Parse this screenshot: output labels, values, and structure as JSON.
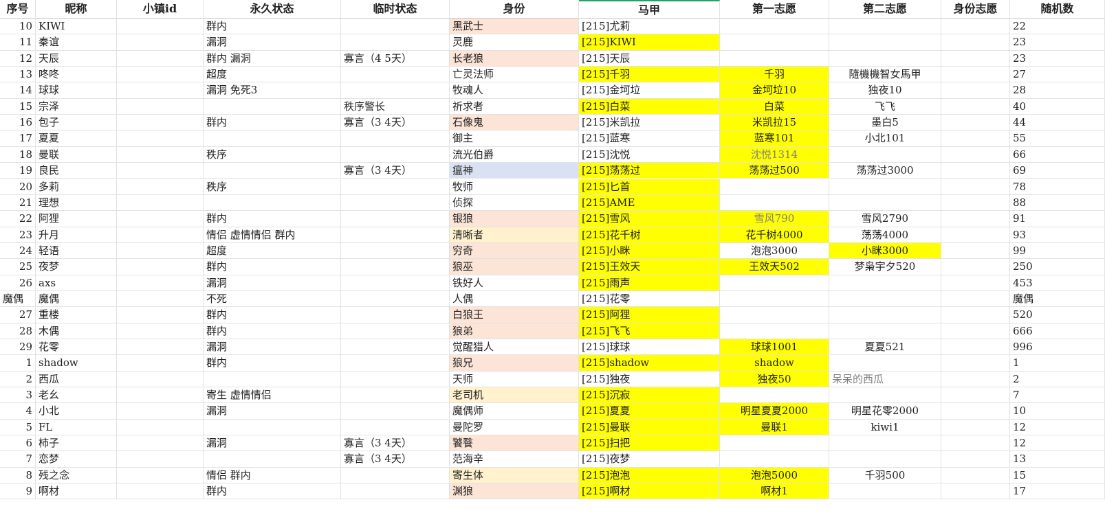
{
  "colors": {
    "yellow": "#ffff00",
    "peach": "#fce4d6",
    "cream": "#fff2cc",
    "lavender": "#d9e1f2",
    "header_accent": "#21a366",
    "text_gray": "#7f7f7f",
    "text_dark": "#333333"
  },
  "columns": [
    {
      "key": "seq",
      "label": "序号",
      "align": "num"
    },
    {
      "key": "nick",
      "label": "昵称",
      "align": "lft"
    },
    {
      "key": "townid",
      "label": "小镇id",
      "align": "lft"
    },
    {
      "key": "perm",
      "label": "永久状态",
      "align": "lft"
    },
    {
      "key": "temp",
      "label": "临时状态",
      "align": "lft"
    },
    {
      "key": "role",
      "label": "身份",
      "align": "lft"
    },
    {
      "key": "alt",
      "label": "马甲",
      "align": "lft",
      "active": true
    },
    {
      "key": "wish1",
      "label": "第一志愿",
      "align": "ctr"
    },
    {
      "key": "wish2",
      "label": "第二志愿",
      "align": "ctr"
    },
    {
      "key": "rolewish",
      "label": "身份志愿",
      "align": "ctr"
    },
    {
      "key": "rand",
      "label": "随机数",
      "align": "lft"
    }
  ],
  "rows": [
    {
      "seq": "10",
      "nick": "KIWI",
      "perm": "群内",
      "temp": "",
      "role": "黑武士",
      "alt": "[215]尤莉",
      "wish1": "",
      "wish2": "",
      "rand": "22",
      "bg": {
        "role": "peach"
      }
    },
    {
      "seq": "11",
      "nick": "秦谊",
      "perm": "漏洞",
      "temp": "",
      "role": "灵鹿",
      "alt": "[215]KIWI",
      "wish1": "",
      "wish2": "",
      "rand": "23",
      "bg": {
        "alt": "yellow"
      }
    },
    {
      "seq": "12",
      "nick": "天辰",
      "perm": "群内 漏洞",
      "temp": "寡言（4 5天）",
      "role": "长老狼",
      "alt": "[215]天辰",
      "wish1": "",
      "wish2": "",
      "rand": "23",
      "bg": {
        "role": "peach"
      }
    },
    {
      "seq": "13",
      "nick": "咚咚",
      "perm": "超度",
      "temp": "",
      "role": "亡灵法师",
      "alt": "[215]千羽",
      "wish1": "千羽",
      "wish2": "隨機機智女馬甲",
      "rand": "27",
      "bg": {
        "alt": "yellow",
        "wish1": "yellow"
      }
    },
    {
      "seq": "14",
      "nick": "球球",
      "perm": "漏洞 免死3",
      "temp": "",
      "role": "牧魂人",
      "alt": "[215]金坷垃",
      "wish1": "金坷垃10",
      "wish2": "独夜10",
      "rand": "28",
      "bg": {
        "wish1": "yellow"
      }
    },
    {
      "seq": "15",
      "nick": "宗泽",
      "perm": "",
      "temp": "秩序警长",
      "role": "祈求者",
      "alt": "[215]白菜",
      "wish1": "白菜",
      "wish2": "飞飞",
      "rand": "40",
      "bg": {
        "alt": "yellow",
        "wish1": "yellow"
      }
    },
    {
      "seq": "16",
      "nick": "包子",
      "perm": "群内",
      "temp": "寡言（3 4天）",
      "role": "石像鬼",
      "alt": "[215]米凯拉",
      "wish1": "米凯拉15",
      "wish2": "墨白5",
      "rand": "44",
      "bg": {
        "role": "peach",
        "wish1": "yellow"
      }
    },
    {
      "seq": "17",
      "nick": "夏夏",
      "perm": "",
      "temp": "",
      "role": "御主",
      "alt": "[215]蓝寒",
      "wish1": "蓝寒101",
      "wish2": "小北101",
      "rand": "55",
      "bg": {
        "wish1": "yellow"
      }
    },
    {
      "seq": "18",
      "nick": "曼联",
      "perm": "秩序",
      "temp": "",
      "role": "流光伯爵",
      "alt": "[215]沈悦",
      "wish1": "沈悦1314",
      "wish2": "",
      "rand": "66",
      "bg": {
        "wish1": "yellow"
      },
      "gray": {
        "wish1": true
      }
    },
    {
      "seq": "19",
      "nick": "良民",
      "perm": "",
      "temp": "寡言（3 4天）",
      "role": "瘟神",
      "alt": "[215]荡荡过",
      "wish1": "荡荡过500",
      "wish2": "荡荡过3000",
      "rand": "69",
      "bg": {
        "role": "lavender",
        "alt": "yellow",
        "wish1": "yellow"
      }
    },
    {
      "seq": "20",
      "nick": "多莉",
      "perm": "秩序",
      "temp": "",
      "role": "牧师",
      "alt": "[215]匕首",
      "wish1": "",
      "wish2": "",
      "rand": "78",
      "bg": {
        "alt": "yellow"
      }
    },
    {
      "seq": "21",
      "nick": "理想",
      "perm": "",
      "temp": "",
      "role": "侦探",
      "alt": "[215]AME",
      "wish1": "",
      "wish2": "",
      "rand": "88",
      "bg": {
        "alt": "yellow"
      }
    },
    {
      "seq": "22",
      "nick": "阿狸",
      "perm": "群内",
      "temp": "",
      "role": "银狼",
      "alt": "[215]雪风",
      "wish1": "雪风790",
      "wish2": "雪风2790",
      "rand": "91",
      "bg": {
        "role": "peach",
        "alt": "yellow",
        "wish1": "yellow"
      },
      "gray": {
        "wish1": true
      }
    },
    {
      "seq": "23",
      "nick": "升月",
      "perm": "情侣 虚情情侣 群内",
      "temp": "",
      "role": "清晰者",
      "alt": "[215]花千树",
      "wish1": "花千树4000",
      "wish2": "荡荡4000",
      "rand": "93",
      "bg": {
        "role": "cream",
        "alt": "yellow",
        "wish1": "yellow"
      }
    },
    {
      "seq": "24",
      "nick": "轻语",
      "perm": "超度",
      "temp": "",
      "role": "穷奇",
      "alt": "[215]小眯",
      "wish1": "泡泡3000",
      "wish2": "小眯3000",
      "rand": "99",
      "bg": {
        "role": "peach",
        "alt": "yellow",
        "wish2": "yellow"
      }
    },
    {
      "seq": "25",
      "nick": "夜梦",
      "perm": "群内",
      "temp": "",
      "role": "狼巫",
      "alt": "[215]王效天",
      "wish1": "王效天502",
      "wish2": "梦枭宇夕520",
      "rand": "250",
      "bg": {
        "role": "peach",
        "alt": "yellow",
        "wish1": "yellow"
      }
    },
    {
      "seq": "26",
      "nick": "axs",
      "perm": "漏洞",
      "temp": "",
      "role": "铁好人",
      "alt": "[215]雨声",
      "wish1": "",
      "wish2": "",
      "rand": "453",
      "bg": {
        "alt": "yellow"
      }
    },
    {
      "seq": "魔偶",
      "nick": "魔偶",
      "perm": "不死",
      "temp": "",
      "role": "人偶",
      "alt": "[215]花零",
      "wish1": "",
      "wish2": "",
      "rand": "魔偶",
      "bg": {},
      "seqLeft": true
    },
    {
      "seq": "27",
      "nick": "重楼",
      "perm": "群内",
      "temp": "",
      "role": "白狼王",
      "alt": "[215]阿狸",
      "wish1": "",
      "wish2": "",
      "rand": "520",
      "bg": {
        "role": "peach",
        "alt": "yellow"
      }
    },
    {
      "seq": "28",
      "nick": "木偶",
      "perm": "群内",
      "temp": "",
      "role": "狼弟",
      "alt": "[215]飞飞",
      "wish1": "",
      "wish2": "",
      "rand": "666",
      "bg": {
        "role": "peach",
        "alt": "yellow"
      }
    },
    {
      "seq": "29",
      "nick": "花零",
      "perm": "漏洞",
      "temp": "",
      "role": "觉醒猎人",
      "alt": "[215]球球",
      "wish1": "球球1001",
      "wish2": "夏夏521",
      "rand": "996",
      "bg": {
        "wish1": "yellow"
      }
    },
    {
      "seq": "1",
      "nick": "shadow",
      "perm": "群内",
      "temp": "",
      "role": "狼兄",
      "alt": "[215]shadow",
      "wish1": "shadow",
      "wish2": "",
      "rand": "1",
      "bg": {
        "role": "peach",
        "alt": "yellow",
        "wish1": "yellow"
      }
    },
    {
      "seq": "2",
      "nick": "西瓜",
      "perm": "",
      "temp": "",
      "role": "天师",
      "alt": "[215]独夜",
      "wish1": "独夜50",
      "wish2": "呆呆的西瓜",
      "rand": "2",
      "bg": {
        "wish1": "yellow"
      },
      "gray": {
        "wish2": true
      },
      "wish2Left": true
    },
    {
      "seq": "3",
      "nick": "老幺",
      "perm": "寄生 虚情情侣",
      "temp": "",
      "role": "老司机",
      "alt": "[215]沉寂",
      "wish1": "",
      "wish2": "",
      "rand": "7",
      "bg": {
        "role": "cream",
        "alt": "yellow"
      }
    },
    {
      "seq": "4",
      "nick": "小北",
      "perm": "漏洞",
      "temp": "",
      "role": "魔偶师",
      "alt": "[215]夏夏",
      "wish1": "明星夏夏2000",
      "wish2": "明星花零2000",
      "rand": "10",
      "bg": {
        "alt": "yellow",
        "wish1": "yellow"
      }
    },
    {
      "seq": "5",
      "nick": "FL",
      "perm": "",
      "temp": "",
      "role": "曼陀罗",
      "alt": "[215]曼联",
      "wish1": "曼联1",
      "wish2": "kiwi1",
      "rand": "12",
      "bg": {
        "alt": "yellow",
        "wish1": "yellow"
      }
    },
    {
      "seq": "6",
      "nick": "柿子",
      "perm": "漏洞",
      "temp": "寡言（3 4天）",
      "role": "饕餮",
      "alt": "[215]扫把",
      "wish1": "",
      "wish2": "",
      "rand": "12",
      "bg": {
        "role": "peach",
        "alt": "yellow"
      }
    },
    {
      "seq": "7",
      "nick": "恋梦",
      "perm": "",
      "temp": "寡言（3 4天）",
      "role": "范海辛",
      "alt": "[215]夜梦",
      "wish1": "",
      "wish2": "",
      "rand": "13",
      "bg": {}
    },
    {
      "seq": "8",
      "nick": "残之念",
      "perm": "情侣 群内",
      "temp": "",
      "role": "寄生体",
      "alt": "[215]泡泡",
      "wish1": "泡泡5000",
      "wish2": "千羽500",
      "rand": "15",
      "bg": {
        "role": "cream",
        "alt": "yellow",
        "wish1": "yellow"
      }
    },
    {
      "seq": "9",
      "nick": "啊材",
      "perm": "群内",
      "temp": "",
      "role": "渊狼",
      "alt": "[215]啊材",
      "wish1": "啊材1",
      "wish2": "",
      "rand": "17",
      "bg": {
        "role": "peach",
        "alt": "yellow",
        "wish1": "yellow"
      }
    }
  ]
}
